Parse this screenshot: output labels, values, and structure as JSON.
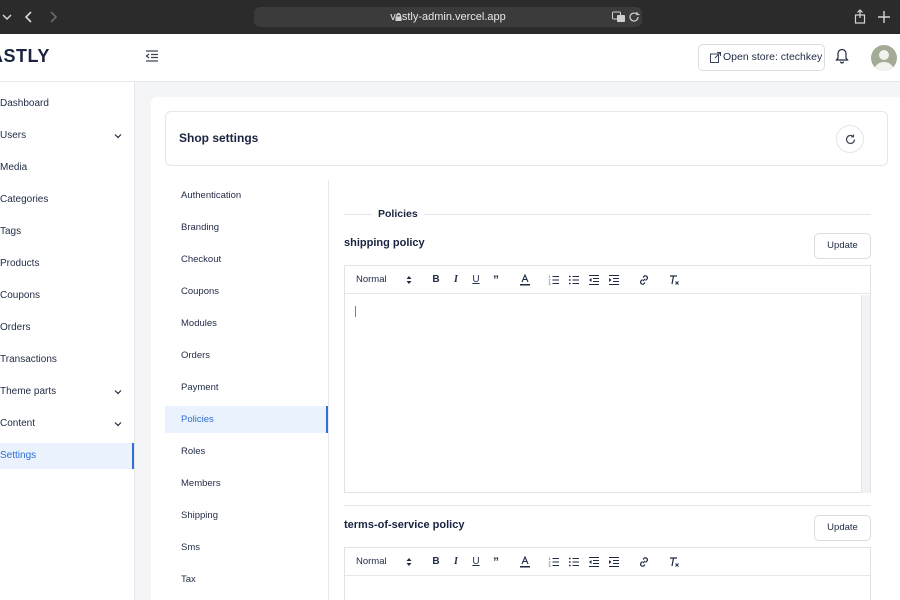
{
  "browser": {
    "url": "vastly-admin.vercel.app"
  },
  "header": {
    "logo": "ASTLY",
    "open_store_label": "Open store: ctechkey"
  },
  "sidebar": {
    "items": [
      {
        "label": "Dashboard"
      },
      {
        "label": "Users"
      },
      {
        "label": "Media"
      },
      {
        "label": "Categories"
      },
      {
        "label": "Tags"
      },
      {
        "label": "Products"
      },
      {
        "label": "Coupons"
      },
      {
        "label": "Orders"
      },
      {
        "label": "Transactions"
      },
      {
        "label": "Theme parts"
      },
      {
        "label": "Content"
      },
      {
        "label": "Settings"
      }
    ]
  },
  "settings": {
    "title": "Shop settings",
    "menu": [
      {
        "label": "Authentication"
      },
      {
        "label": "Branding"
      },
      {
        "label": "Checkout"
      },
      {
        "label": "Coupons"
      },
      {
        "label": "Modules"
      },
      {
        "label": "Orders"
      },
      {
        "label": "Payment"
      },
      {
        "label": "Policies"
      },
      {
        "label": "Roles"
      },
      {
        "label": "Members"
      },
      {
        "label": "Shipping"
      },
      {
        "label": "Sms"
      },
      {
        "label": "Tax"
      }
    ]
  },
  "policies": {
    "section_title": "Policies",
    "update_label": "Update",
    "format_value": "Normal",
    "items": [
      {
        "label": "shipping policy"
      },
      {
        "label": "terms-of-service policy"
      }
    ]
  },
  "colors": {
    "accent": "#2f6fd6",
    "active_bg": "#eaf2fd"
  },
  "icons": [
    "lock-icon",
    "translate-icon",
    "reload-icon",
    "share-icon",
    "new-tab-icon",
    "collapse-menu-icon",
    "external-link-icon",
    "bell-icon",
    "refresh-icon",
    "chevron-down-icon",
    "bold-icon",
    "italic-icon",
    "underline-icon",
    "quote-icon",
    "text-color-icon",
    "ordered-list-icon",
    "bullet-list-icon",
    "outdent-icon",
    "indent-icon",
    "link-icon",
    "clear-format-icon"
  ]
}
